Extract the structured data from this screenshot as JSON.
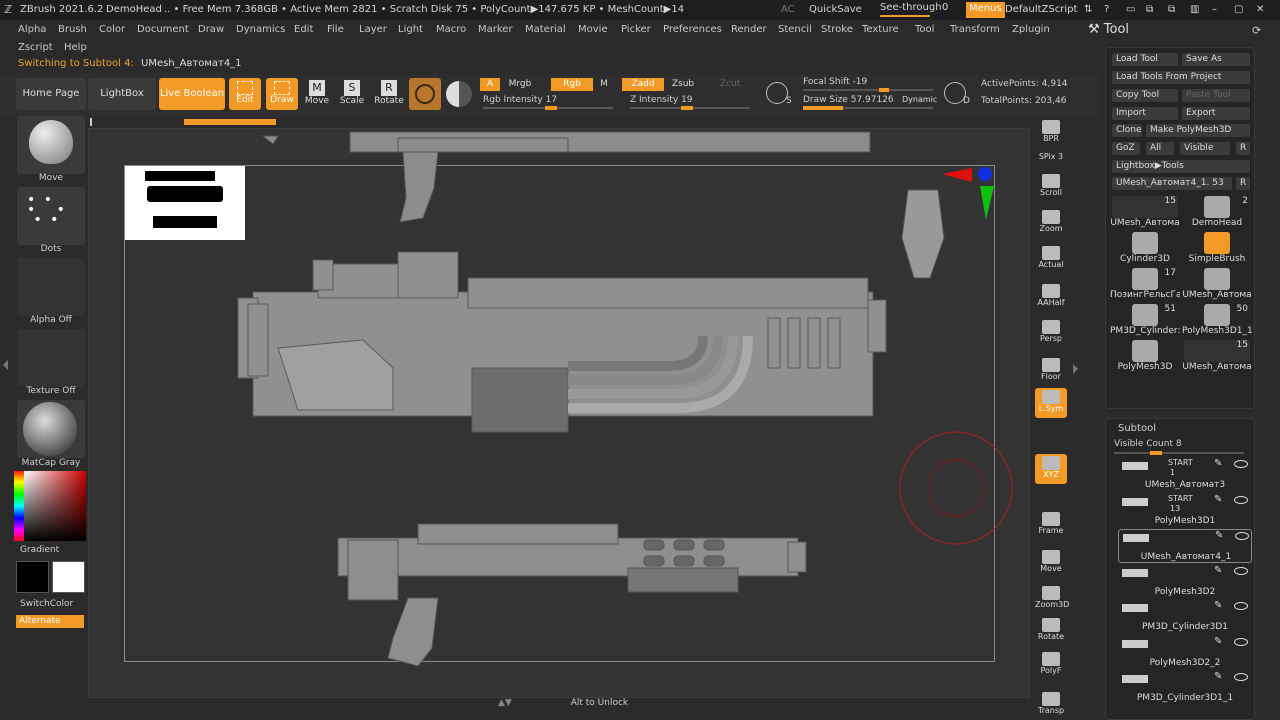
{
  "titlebar": {
    "app": "ZBrush 2021.6.2",
    "project": "DemoHead",
    "status": ".. • Free Mem 7.368GB • Active Mem 2821 • Scratch Disk 75 • PolyCount▶147.675 KP • MeshCount▶14",
    "ac": "AC",
    "quicksave": "QuickSave",
    "see_through": "See-through",
    "see_through_value": "0",
    "menus": "Menus",
    "script": "DefaultZScript"
  },
  "menubar": {
    "row1": [
      "Alpha",
      "Brush",
      "Color",
      "Document",
      "Draw",
      "Dynamics",
      "Edit",
      "File",
      "Layer",
      "Light",
      "Macro",
      "Marker",
      "Material",
      "Movie",
      "Picker",
      "Preferences",
      "Render",
      "Stencil",
      "Stroke",
      "Texture",
      "Tool",
      "Transform",
      "Zplugin"
    ],
    "row2": [
      "Zscript",
      "Help"
    ],
    "message_prefix": "Switching to Subtool 4:",
    "message_value": "UMesh_Автомат4_1"
  },
  "shelf": {
    "home": "Home Page",
    "lightbox": "LightBox",
    "live_boolean": "Live Boolean",
    "edit": "Edit",
    "draw": "Draw",
    "move": "Move",
    "scale": "Scale",
    "rotate": "Rotate",
    "a": "A",
    "mrgb": "Mrgb",
    "rgb": "Rgb",
    "m": "M",
    "zadd": "Zadd",
    "zsub": "Zsub",
    "zcut": "Zcut",
    "rgb_intensity_label": "Rgb Intensity",
    "rgb_intensity_value": "17",
    "rgb_intensity_fraction": 0.17,
    "z_intensity_label": "Z Intensity",
    "z_intensity_value": "19",
    "z_intensity_fraction": 0.19,
    "focal_shift_label": "Focal Shift",
    "focal_shift_value": "-19",
    "draw_size_label": "Draw Size",
    "draw_size_value": "57.97126",
    "dynamic": "Dynamic",
    "active_points": "ActivePoints: 4,914",
    "total_points": "TotalPoints: 203,46",
    "s_letter": "S",
    "d_letter": "D"
  },
  "leftpanel": {
    "brush": "Move",
    "stroke": "Dots",
    "alpha": "Alpha Off",
    "texture": "Texture Off",
    "material": "MatCap Gray",
    "gradient": "Gradient",
    "switchcolor": "SwitchColor",
    "alternate": "Alternate"
  },
  "rightshelf": [
    "BPR",
    "SPix 3",
    "Scroll",
    "Zoom",
    "Actual",
    "AAHalf",
    "Persp",
    "Floor",
    "L.Sym",
    "XYZ",
    "Frame",
    "Move",
    "Zoom3D",
    "Rotate",
    "PolyF",
    "Transp"
  ],
  "bottom_hint": "Alt to Unlock",
  "toolpanel": {
    "title": "Tool",
    "load_tool": "Load Tool",
    "save_as": "Save As",
    "load_from_project": "Load Tools From Project",
    "copy_tool": "Copy Tool",
    "paste_tool": "Paste Tool",
    "import": "Import",
    "export": "Export",
    "clone": "Clone",
    "make_polymesh": "Make PolyMesh3D",
    "goz": "GoZ",
    "all": "All",
    "visible": "Visible",
    "r": "R",
    "lightbox_tools": "Lightbox▶Tools",
    "current_tool": "UMesh_Автомат4_1.",
    "current_tool_value": "53",
    "tools": [
      {
        "name": "UMesh_Автома",
        "count": "15"
      },
      {
        "name": "DemoHead",
        "count": "2"
      },
      {
        "name": "Cylinder3D",
        "count": ""
      },
      {
        "name": "SimpleBrush",
        "count": ""
      },
      {
        "name": "ПозингРельсГа",
        "count": "17"
      },
      {
        "name": "UMesh_Автома",
        "count": ""
      },
      {
        "name": "PM3D_Cylinder:",
        "count": "51"
      },
      {
        "name": "PolyMesh3D1_1",
        "count": "50"
      },
      {
        "name": "PolyMesh3D",
        "count": ""
      },
      {
        "name": "UMesh_Автома",
        "count": "15"
      }
    ],
    "subtool_title": "Subtool",
    "visible_count_label": "Visible Count",
    "visible_count_value": "8",
    "subtools": [
      {
        "name": "UMesh_Автомат3",
        "tag": "START",
        "num": "1"
      },
      {
        "name": "PolyMesh3D1",
        "tag": "START",
        "num": "13"
      },
      {
        "name": "UMesh_Автомат4_1",
        "tag": "",
        "num": ""
      },
      {
        "name": "PolyMesh3D2",
        "tag": "",
        "num": ""
      },
      {
        "name": "PM3D_Cylinder3D1",
        "tag": "",
        "num": ""
      },
      {
        "name": "PolyMesh3D2_2",
        "tag": "",
        "num": ""
      },
      {
        "name": "PM3D_Cylinder3D1_1",
        "tag": "",
        "num": ""
      }
    ]
  },
  "colors": {
    "accent": "#f29a25",
    "bg": "#2b2b2b",
    "canvas": "#333333"
  }
}
